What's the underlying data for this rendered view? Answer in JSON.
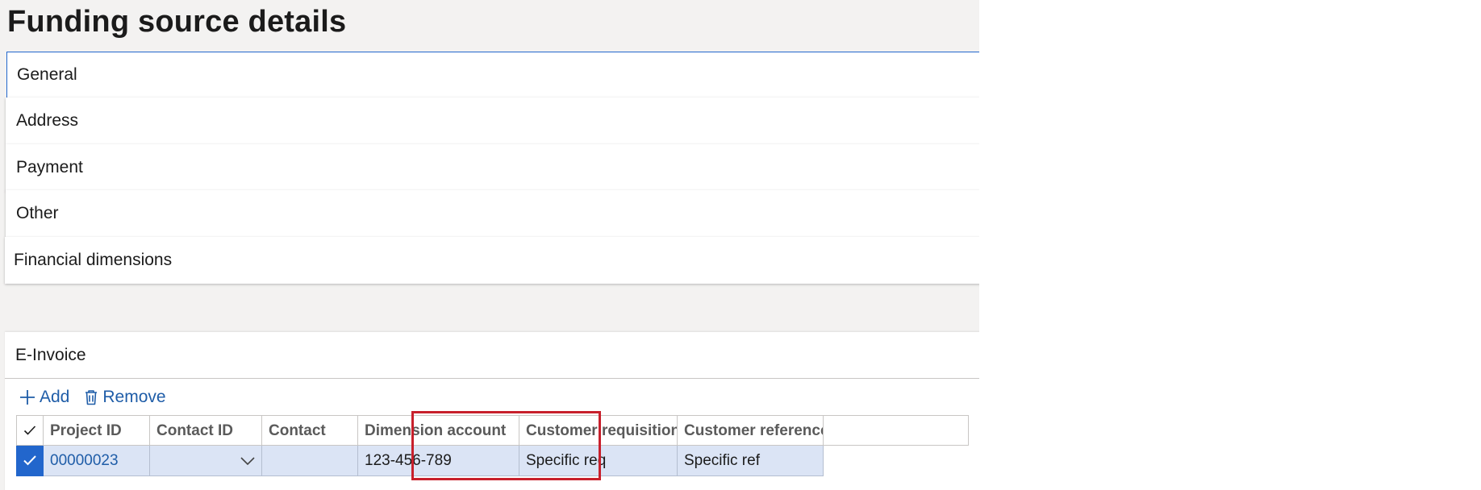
{
  "page": {
    "title": "Funding source details"
  },
  "fasttabs": [
    {
      "label": "General"
    },
    {
      "label": "Address"
    },
    {
      "label": "Payment"
    },
    {
      "label": "Other"
    },
    {
      "label": "Financial dimensions"
    }
  ],
  "einvoice": {
    "label": "E-Invoice",
    "actions": {
      "add_label": "Add",
      "remove_label": "Remove"
    },
    "grid": {
      "columns": [
        "Project ID",
        "Contact ID",
        "Contact",
        "Dimension account",
        "Customer requisition",
        "Customer reference"
      ],
      "rows": [
        {
          "selected": true,
          "project_id": "00000023",
          "contact_id": "",
          "contact": "",
          "dimension_account": "123-456-789",
          "customer_requisition": "Specific req",
          "customer_reference": "Specific ref"
        }
      ]
    }
  },
  "icons": {
    "add": "plus-icon",
    "remove": "trash-icon",
    "select_all": "checkmark-icon",
    "row_selected": "checkmark-icon",
    "dropdown": "chevron-down-icon"
  },
  "colors": {
    "accent": "#2266cc",
    "link": "#1f5da8",
    "selected_row": "#dbe4f5",
    "highlight": "#c8202c",
    "page_background": "#f3f2f1"
  }
}
